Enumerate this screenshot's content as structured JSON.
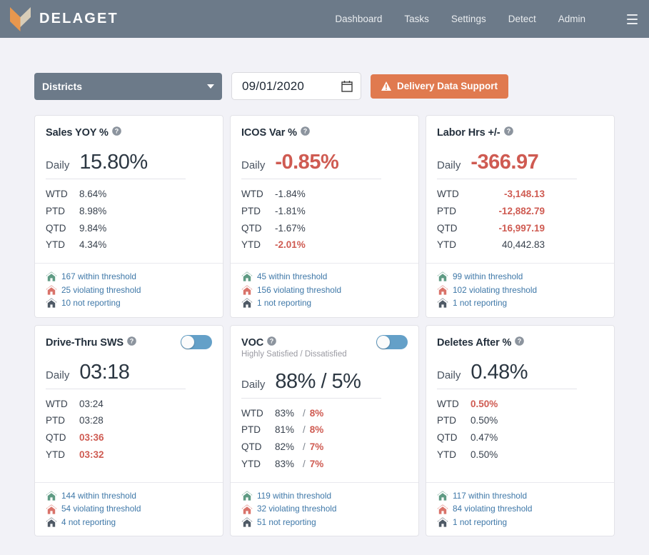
{
  "nav": {
    "brand": "DELAGET",
    "logo_icon": "delaget-chevron-logo",
    "menu_icon": "hamburger-menu-icon",
    "links": [
      {
        "label": "Dashboard"
      },
      {
        "label": "Tasks"
      },
      {
        "label": "Settings"
      },
      {
        "label": "Detect"
      },
      {
        "label": "Admin"
      }
    ]
  },
  "toolbar": {
    "district_select": {
      "label": "Districts",
      "icon": "chevron-down-icon"
    },
    "date_field": {
      "value": "09/01/2020",
      "placeholder": "MM/DD/YYYY",
      "icon": "calendar-icon"
    },
    "support_button": {
      "label": "Delivery Data Support",
      "icon": "warning-triangle-icon",
      "color": "#e07a4f"
    }
  },
  "labels": {
    "daily": "Daily",
    "within": "within threshold",
    "violating": "violating threshold",
    "not_reporting": "not reporting",
    "help_icon": "help-circle-icon",
    "within_icon": "house-green-icon",
    "violating_icon": "house-red-icon",
    "not_reporting_icon": "house-gray-icon"
  },
  "colors": {
    "nav_bg": "#6c7a89",
    "accent_orange": "#e07a4f",
    "negative_red": "#cf5b52",
    "link_blue": "#3f78a8",
    "toggle_on": "#64a0c8",
    "house_green": "#5f9b84",
    "house_red": "#d9736a",
    "house_gray": "#4f5a66"
  },
  "cards": [
    {
      "title": "Sales YOY %",
      "subtitle": null,
      "toggle": null,
      "daily": {
        "value": "15.80%",
        "negative": false
      },
      "layout": "single",
      "rows": [
        {
          "key": "WTD",
          "value": "8.64%",
          "negative": false
        },
        {
          "key": "PTD",
          "value": "8.98%",
          "negative": false
        },
        {
          "key": "QTD",
          "value": "9.84%",
          "negative": false
        },
        {
          "key": "YTD",
          "value": "4.34%",
          "negative": false
        }
      ],
      "thresholds": {
        "within": "167",
        "violating": "25",
        "not_reporting": "10"
      }
    },
    {
      "title": "ICOS Var %",
      "subtitle": null,
      "toggle": null,
      "daily": {
        "value": "-0.85%",
        "negative": true
      },
      "layout": "single",
      "rows": [
        {
          "key": "WTD",
          "value": "-1.84%",
          "negative": false
        },
        {
          "key": "PTD",
          "value": "-1.81%",
          "negative": false
        },
        {
          "key": "QTD",
          "value": "-1.67%",
          "negative": false
        },
        {
          "key": "YTD",
          "value": "-2.01%",
          "negative": true
        }
      ],
      "thresholds": {
        "within": "45",
        "violating": "156",
        "not_reporting": "1"
      }
    },
    {
      "title": "Labor Hrs +/-",
      "subtitle": null,
      "toggle": null,
      "daily": {
        "value": "-366.97",
        "negative": true
      },
      "layout": "numeric",
      "rows": [
        {
          "key": "WTD",
          "value": "-3,148.13",
          "negative": true
        },
        {
          "key": "PTD",
          "value": "-12,882.79",
          "negative": true
        },
        {
          "key": "QTD",
          "value": "-16,997.19",
          "negative": true
        },
        {
          "key": "YTD",
          "value": "40,442.83",
          "negative": false
        }
      ],
      "thresholds": {
        "within": "99",
        "violating": "102",
        "not_reporting": "1"
      }
    },
    {
      "title": "Drive-Thru SWS",
      "subtitle": null,
      "toggle": {
        "state": "on"
      },
      "daily": {
        "value": "03:18",
        "negative": false
      },
      "layout": "single",
      "rows": [
        {
          "key": "WTD",
          "value": "03:24",
          "negative": false
        },
        {
          "key": "PTD",
          "value": "03:28",
          "negative": false
        },
        {
          "key": "QTD",
          "value": "03:36",
          "negative": true
        },
        {
          "key": "YTD",
          "value": "03:32",
          "negative": true
        }
      ],
      "thresholds": {
        "within": "144",
        "violating": "54",
        "not_reporting": "4"
      }
    },
    {
      "title": "VOC",
      "subtitle": "Highly Satisfied / Dissatisfied",
      "toggle": {
        "state": "on"
      },
      "daily": {
        "value": "88%  /  5%",
        "negative": false
      },
      "layout": "dual",
      "rows": [
        {
          "key": "WTD",
          "value": "83%",
          "value2": "8%",
          "negative": false,
          "negative2": true
        },
        {
          "key": "PTD",
          "value": "81%",
          "value2": "8%",
          "negative": false,
          "negative2": true
        },
        {
          "key": "QTD",
          "value": "82%",
          "value2": "7%",
          "negative": false,
          "negative2": true
        },
        {
          "key": "YTD",
          "value": "83%",
          "value2": "7%",
          "negative": false,
          "negative2": true
        }
      ],
      "thresholds": {
        "within": "119",
        "violating": "32",
        "not_reporting": "51"
      }
    },
    {
      "title": "Deletes After %",
      "subtitle": null,
      "toggle": null,
      "daily": {
        "value": "0.48%",
        "negative": false
      },
      "layout": "single",
      "rows": [
        {
          "key": "WTD",
          "value": "0.50%",
          "negative": true
        },
        {
          "key": "PTD",
          "value": "0.50%",
          "negative": false
        },
        {
          "key": "QTD",
          "value": "0.47%",
          "negative": false
        },
        {
          "key": "YTD",
          "value": "0.50%",
          "negative": false
        }
      ],
      "thresholds": {
        "within": "117",
        "violating": "84",
        "not_reporting": "1"
      }
    }
  ]
}
